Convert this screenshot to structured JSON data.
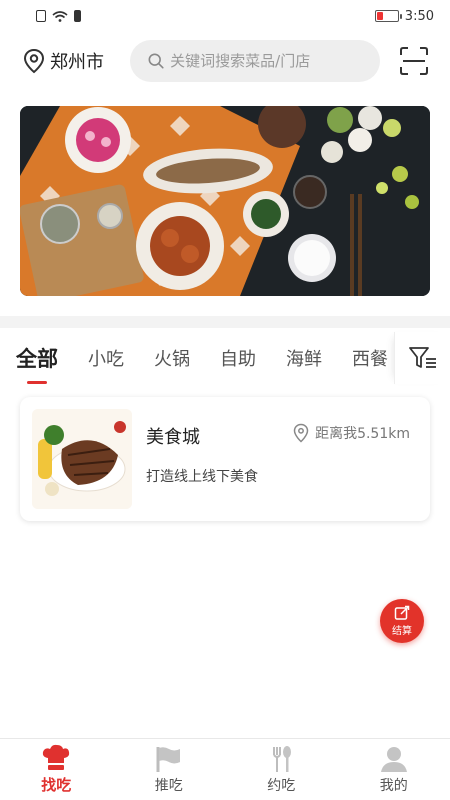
{
  "status_bar": {
    "time": "3:50",
    "battery_level": 0.3
  },
  "header": {
    "city": "郑州市",
    "search_placeholder": "关键词搜索菜品/门店"
  },
  "tabs": [
    {
      "label": "全部",
      "active": true
    },
    {
      "label": "小吃",
      "active": false
    },
    {
      "label": "火锅",
      "active": false
    },
    {
      "label": "自助",
      "active": false
    },
    {
      "label": "海鲜",
      "active": false
    },
    {
      "label": "西餐",
      "active": false
    }
  ],
  "store": {
    "name": "美食城",
    "distance": "距离我5.51km",
    "description": "打造线上线下美食"
  },
  "fab": {
    "label": "结算"
  },
  "bottom_nav": [
    {
      "label": "找吃",
      "icon": "chef-hat-icon",
      "active": true
    },
    {
      "label": "推吃",
      "icon": "flag-icon",
      "active": false
    },
    {
      "label": "约吃",
      "icon": "fork-spoon-icon",
      "active": false
    },
    {
      "label": "我的",
      "icon": "user-icon",
      "active": false
    }
  ],
  "colors": {
    "accent": "#e0312f",
    "search_bg": "#eeeeee",
    "band_bg": "#f3f3f3"
  }
}
